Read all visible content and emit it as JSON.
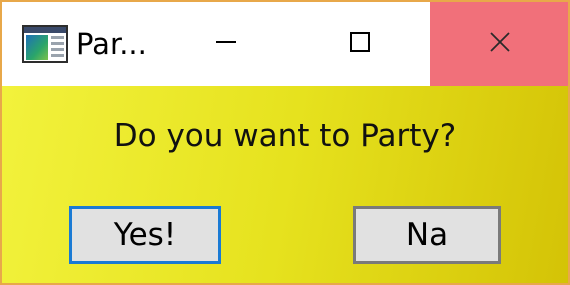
{
  "window": {
    "title": "Par...",
    "app_icon": "application-window-icon",
    "border_color": "#e8a84a",
    "controls": {
      "minimize_icon": "minimize-icon",
      "maximize_icon": "maximize-icon",
      "close_icon": "close-icon",
      "close_hover_color": "#f1707a"
    }
  },
  "dialog": {
    "message": "Do you want to Party?",
    "background_colors": [
      "#f2f23c",
      "#d4c306"
    ],
    "buttons": {
      "yes_label": "Yes!",
      "no_label": "Na",
      "focus_color": "#1a7ad4"
    }
  }
}
